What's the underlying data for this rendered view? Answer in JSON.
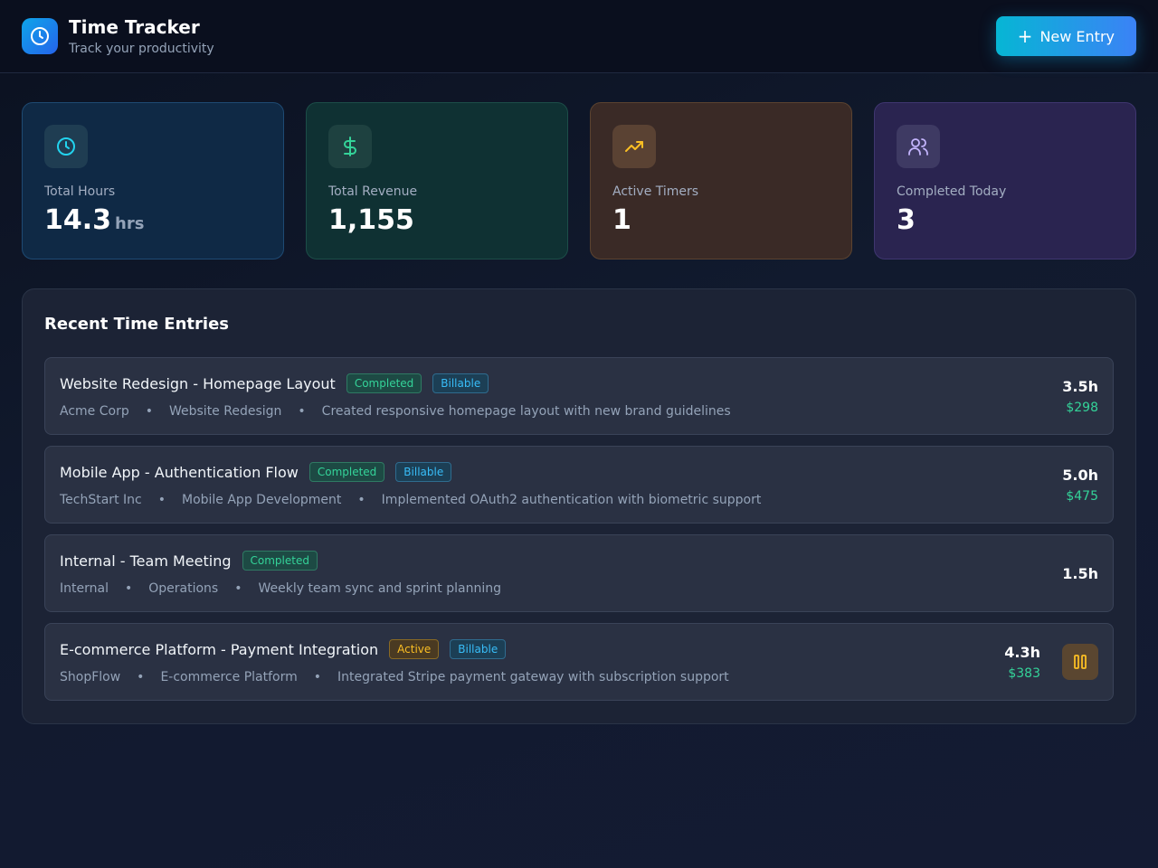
{
  "header": {
    "title": "Time Tracker",
    "subtitle": "Track your productivity",
    "new_entry_label": "New Entry"
  },
  "stats": [
    {
      "label": "Total Hours",
      "value": "14.3",
      "unit": "hrs",
      "icon": "clock-icon",
      "color": "#22d3ee"
    },
    {
      "label": "Total Revenue",
      "value": "1,155",
      "unit": "",
      "icon": "dollar-icon",
      "color": "#34d399"
    },
    {
      "label": "Active Timers",
      "value": "1",
      "unit": "",
      "icon": "trending-up-icon",
      "color": "#fbbf24"
    },
    {
      "label": "Completed Today",
      "value": "3",
      "unit": "",
      "icon": "users-icon",
      "color": "#c4b5fd"
    }
  ],
  "panel": {
    "title": "Recent Time Entries",
    "entries": [
      {
        "title": "Website Redesign - Homepage Layout",
        "status": "Completed",
        "billable": "Billable",
        "client": "Acme Corp",
        "project": "Website Redesign",
        "description": "Created responsive homepage layout with new brand guidelines",
        "hours": "3.5h",
        "amount": "$298"
      },
      {
        "title": "Mobile App - Authentication Flow",
        "status": "Completed",
        "billable": "Billable",
        "client": "TechStart Inc",
        "project": "Mobile App Development",
        "description": "Implemented OAuth2 authentication with biometric support",
        "hours": "5.0h",
        "amount": "$475"
      },
      {
        "title": "Internal - Team Meeting",
        "status": "Completed",
        "client": "Internal",
        "project": "Operations",
        "description": "Weekly team sync and sprint planning",
        "hours": "1.5h"
      },
      {
        "title": "E-commerce Platform - Payment Integration",
        "status": "Active",
        "billable": "Billable",
        "client": "ShopFlow",
        "project": "E-commerce Platform",
        "description": "Integrated Stripe payment gateway with subscription support",
        "hours": "4.3h",
        "amount": "$383"
      }
    ]
  },
  "colors": {
    "accent": "#0ea5e9",
    "completed": "#34d399",
    "billable": "#38bdf8",
    "active": "#fbbf24"
  }
}
